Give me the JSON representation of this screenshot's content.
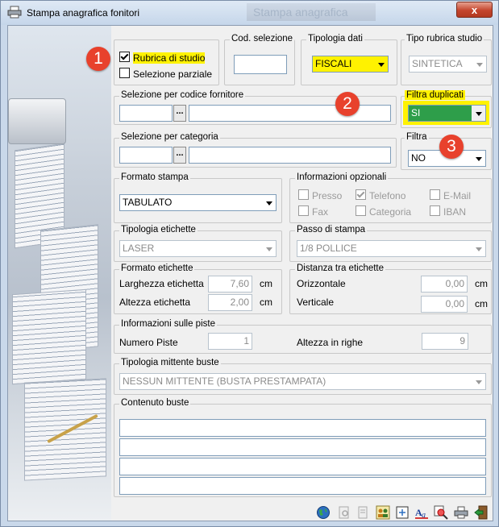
{
  "window": {
    "title": "Stampa anagrafica fonitori",
    "ghost_title": "Stampa anagrafica",
    "close_label": "x"
  },
  "annotations": [
    "1",
    "2",
    "3"
  ],
  "selection": {
    "rubrica_label": "Rubrica di studio",
    "rubrica_checked": true,
    "parziale_label": "Selezione parziale",
    "parziale_checked": false
  },
  "cod_selezione": {
    "legend": "Cod. selezione",
    "value": ""
  },
  "tipologia_dati": {
    "legend": "Tipologia dati",
    "value": "FISCALI"
  },
  "tipo_rubrica": {
    "legend": "Tipo rubrica studio",
    "value": "SINTETICA"
  },
  "selezione_codice": {
    "legend": "Selezione per codice fornitore",
    "code": "",
    "desc": "",
    "button": "..."
  },
  "filtra_duplicati": {
    "legend": "Filtra duplicati",
    "value": "SI"
  },
  "selezione_categoria": {
    "legend": "Selezione per categoria",
    "code": "",
    "desc": "",
    "button": "..."
  },
  "filtra": {
    "legend": "Filtra",
    "value": "NO"
  },
  "formato_stampa": {
    "legend": "Formato stampa",
    "value": "TABULATO"
  },
  "info_opzionali": {
    "legend": "Informazioni opzionali",
    "items": [
      {
        "label": "Presso",
        "checked": false
      },
      {
        "label": "Telefono",
        "checked": true
      },
      {
        "label": "E-Mail",
        "checked": false
      },
      {
        "label": "Fax",
        "checked": false
      },
      {
        "label": "Categoria",
        "checked": false
      },
      {
        "label": "IBAN",
        "checked": false
      }
    ]
  },
  "tipologia_etichette": {
    "legend": "Tipologia etichette",
    "value": "LASER"
  },
  "passo_stampa": {
    "legend": "Passo di stampa",
    "value": "1/8 POLLICE"
  },
  "formato_etichette": {
    "legend": "Formato etichette",
    "larghezza_label": "Larghezza etichetta",
    "larghezza_value": "7,60",
    "altezza_label": "Altezza etichetta",
    "altezza_value": "2,00",
    "unit": "cm"
  },
  "distanza": {
    "legend": "Distanza tra etichette",
    "orizzontale_label": "Orizzontale",
    "orizzontale_value": "0,00",
    "verticale_label": "Verticale",
    "verticale_value": "0,00",
    "unit": "cm"
  },
  "piste": {
    "legend": "Informazioni sulle piste",
    "numero_label": "Numero Piste",
    "numero_value": "1",
    "altezza_label": "Altezza in righe",
    "altezza_value": "9"
  },
  "mittente": {
    "legend": "Tipologia mittente buste",
    "value": "NESSUN MITTENTE (BUSTA PRESTAMPATA)"
  },
  "contenuto": {
    "legend": "Contenuto buste",
    "lines": [
      "",
      "",
      "",
      ""
    ]
  },
  "colors": {
    "highlight": "#fff200",
    "badge": "#e8412c",
    "duplicati_bg": "#2e9e4a"
  },
  "toolbar": [
    "globe-icon",
    "preview-disabled-icon",
    "document-disabled-icon",
    "users-icon",
    "page-setup-icon",
    "font-icon",
    "zoom-icon",
    "printer-icon",
    "exit-icon"
  ]
}
